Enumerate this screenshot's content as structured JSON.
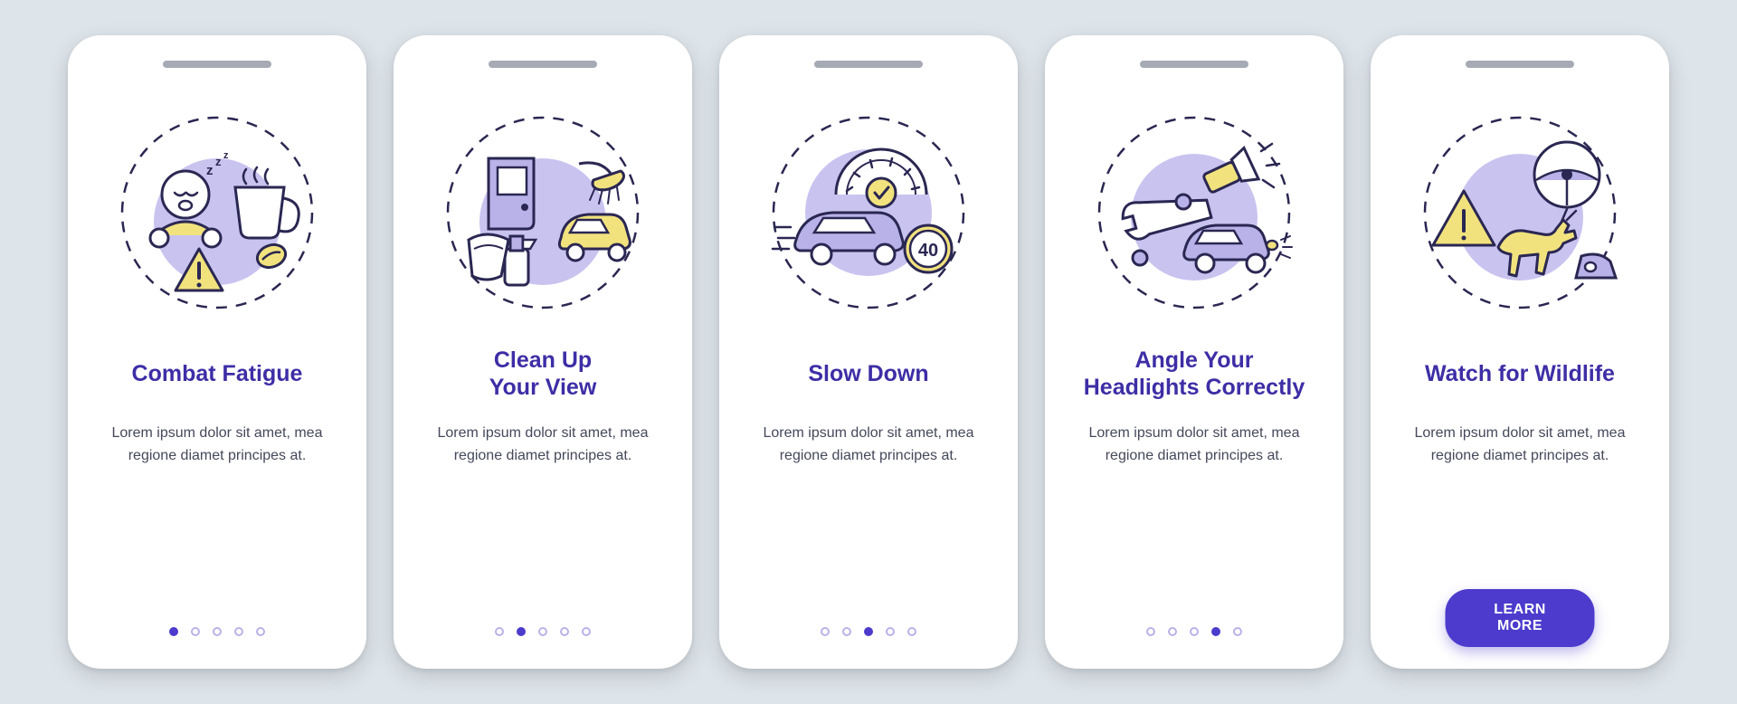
{
  "colors": {
    "background": "#dde4ea",
    "card": "#ffffff",
    "primary": "#4c3bcc",
    "title": "#3d2ea6",
    "body": "#44485a",
    "accentYellow": "#f1e27e",
    "accentLavender": "#b8b2e8",
    "stroke": "#2a2752"
  },
  "screens": [
    {
      "illustration": "combat-fatigue",
      "title": "Combat Fatigue",
      "body": "Lorem ipsum dolor sit amet, mea regione diamet principes at.",
      "activeDot": 0,
      "showDots": true,
      "showCTA": false
    },
    {
      "illustration": "clean-up-view",
      "title": "Clean Up\nYour View",
      "body": "Lorem ipsum dolor sit amet, mea regione diamet principes at.",
      "activeDot": 1,
      "showDots": true,
      "showCTA": false
    },
    {
      "illustration": "slow-down",
      "title": "Slow Down",
      "body": "Lorem ipsum dolor sit amet, mea regione diamet principes at.",
      "activeDot": 2,
      "showDots": true,
      "showCTA": false
    },
    {
      "illustration": "angle-headlights",
      "title": "Angle Your\nHeadlights Correctly",
      "body": "Lorem ipsum dolor sit amet, mea regione diamet principes at.",
      "activeDot": 3,
      "showDots": true,
      "showCTA": false
    },
    {
      "illustration": "watch-wildlife",
      "title": "Watch for Wildlife",
      "body": "Lorem ipsum dolor sit amet, mea regione diamet principes at.",
      "activeDot": 4,
      "showDots": false,
      "showCTA": true
    }
  ],
  "cta_label": "LEARN MORE",
  "dot_count": 5
}
